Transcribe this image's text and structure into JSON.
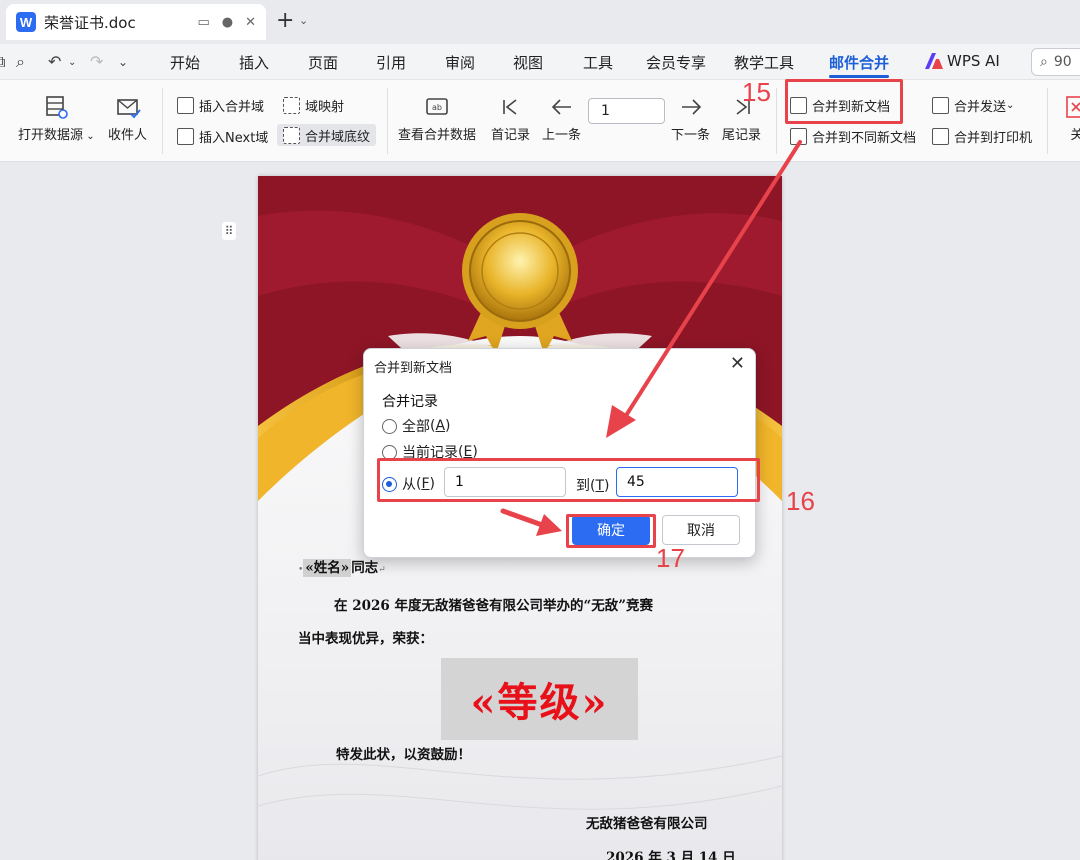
{
  "tab": {
    "logo": "W",
    "title": "荣誉证书.doc"
  },
  "menu": {
    "items": [
      "开始",
      "插入",
      "页面",
      "引用",
      "审阅",
      "视图",
      "工具",
      "会员专享",
      "教学工具",
      "邮件合并",
      "WPS AI"
    ],
    "active": "邮件合并",
    "zoom": "90"
  },
  "ribbon": {
    "open_source": "打开数据源",
    "recipients": "收件人",
    "insert_field": "插入合并域",
    "insert_next": "插入Next域",
    "field_map": "域映射",
    "field_shading": "合并域底纹",
    "view_data": "查看合并数据",
    "first": "首记录",
    "prev": "上一条",
    "record_value": "1",
    "next": "下一条",
    "last": "尾记录",
    "merge_new_doc": "合并到新文档",
    "merge_diff_docs": "合并到不同新文档",
    "merge_send": "合并发送",
    "merge_printer": "合并到打印机",
    "close": "关"
  },
  "document": {
    "name_field": "«姓名»",
    "name_suffix": "同志",
    "para1_line1": "在 2026 年度无敌猪爸爸有限公司举办的“无敌”竞赛",
    "para1_line2": "当中表现优异，荣获：",
    "level_field": "«等级»",
    "closing": "特发此状，以资鼓励！",
    "company": "无敌猪爸爸有限公司",
    "date": "2026 年 3 月 14 日"
  },
  "dialog": {
    "title": "合并到新文档",
    "group": "合并记录",
    "opt_all": "全部",
    "opt_all_key": "A",
    "opt_current": "当前记录",
    "opt_current_key": "E",
    "opt_from": "从",
    "opt_from_key": "F",
    "from_value": "1",
    "to_label": "到",
    "to_key": "T",
    "to_value": "45",
    "ok": "确定",
    "cancel": "取消"
  },
  "annotations": {
    "step15": "15",
    "step16": "16",
    "step17": "17",
    "color": "#e8434b"
  }
}
